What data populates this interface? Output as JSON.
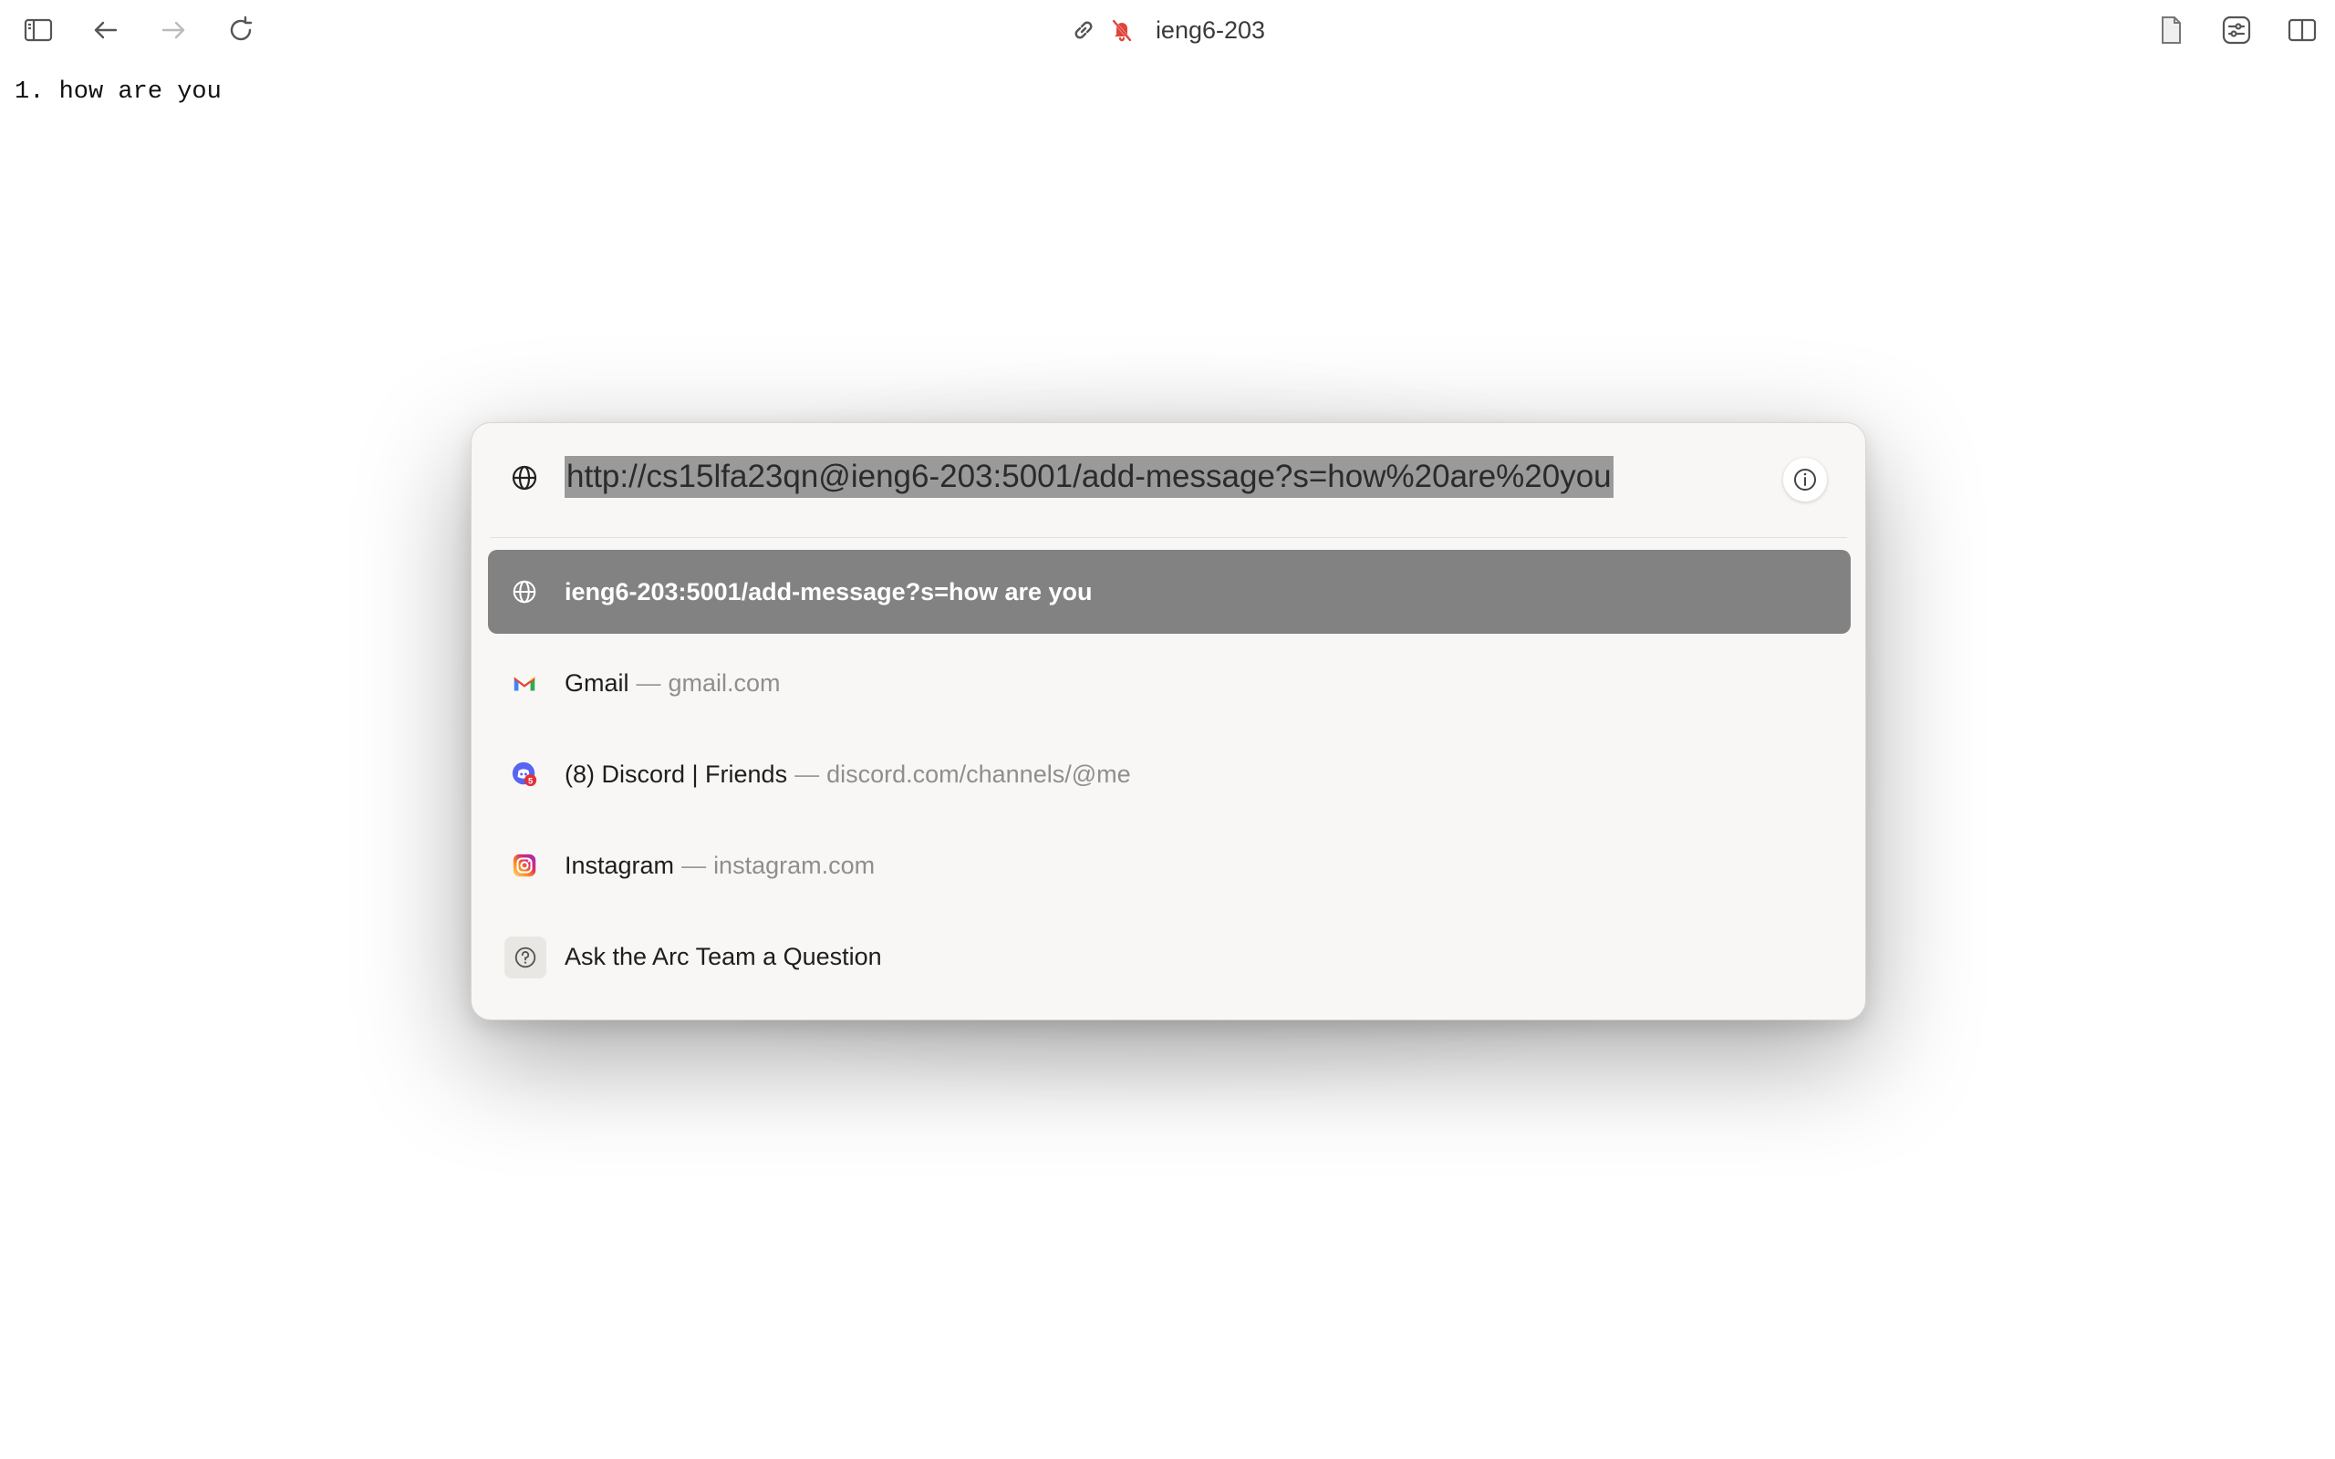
{
  "browser": {
    "tab_title": "ieng6-203"
  },
  "page": {
    "list_item": "1. how are you"
  },
  "command_bar": {
    "url": "http://cs15lfa23qn@ieng6-203:5001/add-message?s=how%20are%20you",
    "suggestions": [
      {
        "title": "ieng6-203:5001/add-message?s=how are you",
        "subtitle": "",
        "icon": "globe-icon",
        "selected": true
      },
      {
        "title": "Gmail",
        "subtitle": "gmail.com",
        "icon": "gmail-icon",
        "selected": false
      },
      {
        "title": "(8) Discord | Friends",
        "subtitle": "discord.com/channels/@me",
        "icon": "discord-icon",
        "selected": false
      },
      {
        "title": "Instagram",
        "subtitle": "instagram.com",
        "icon": "instagram-icon",
        "selected": false
      },
      {
        "title": "Ask the Arc Team a Question",
        "subtitle": "",
        "icon": "question-icon",
        "selected": false
      }
    ],
    "separator": "—"
  },
  "colors": {
    "selected_row": "#828282",
    "url_highlight": "#9a9a9a",
    "panel_bg": "#f8f7f5"
  }
}
